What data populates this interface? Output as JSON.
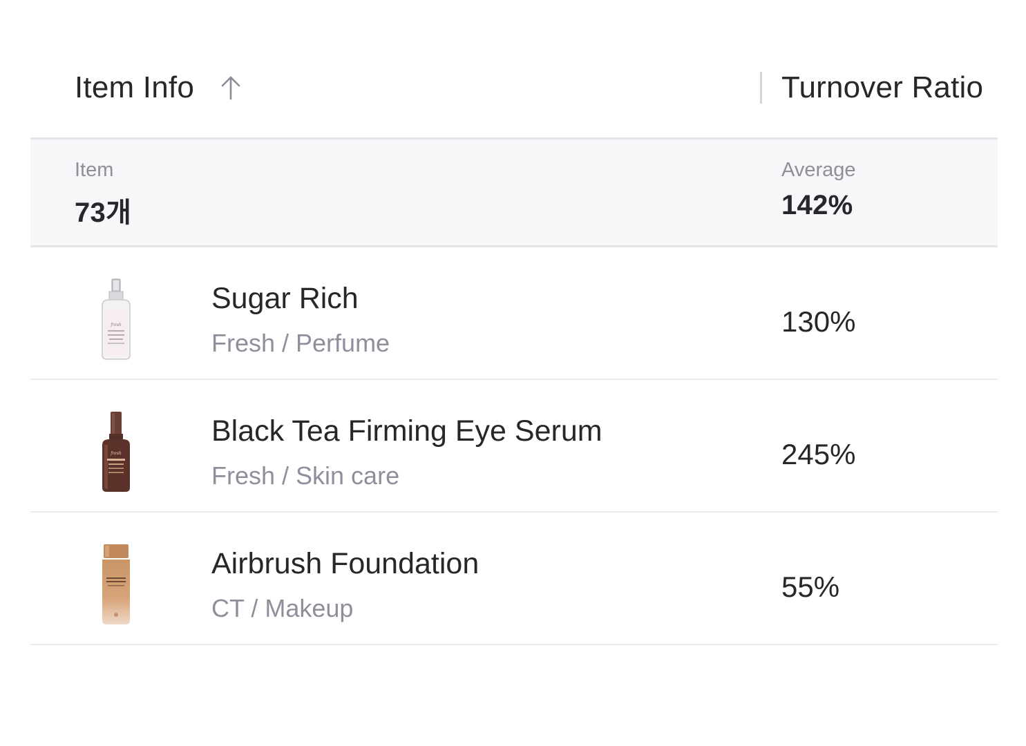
{
  "header": {
    "item_col_label": "Item Info",
    "sort_icon": "arrow-up-icon",
    "ratio_col_label": "Turnover Ratio"
  },
  "summary": {
    "item_caption": "Item",
    "item_count": "73개",
    "ratio_caption": "Average",
    "ratio_value": "142%"
  },
  "rows": [
    {
      "name": "Sugar Rich",
      "meta": "Fresh / Perfume",
      "ratio": "130%",
      "thumb_icon": "perfume-bottle-icon",
      "thumb_brand": "fresh"
    },
    {
      "name": "Black Tea Firming Eye Serum",
      "meta": "Fresh / Skin care",
      "ratio": "245%",
      "thumb_icon": "serum-bottle-icon",
      "thumb_brand": "fresh"
    },
    {
      "name": "Airbrush Foundation",
      "meta": "CT / Makeup",
      "ratio": "55%",
      "thumb_icon": "foundation-bottle-icon",
      "thumb_brand": ""
    }
  ],
  "colors": {
    "text_primary": "#26262b",
    "text_secondary": "#8e8f9c",
    "summary_bg": "#f6f7f9",
    "divider": "#e3e4e8"
  }
}
